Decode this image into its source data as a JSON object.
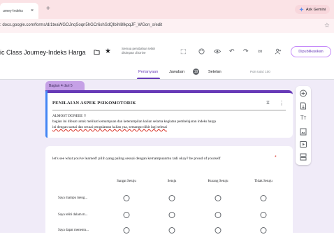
{
  "browser": {
    "tab_title": "urney-Indeks",
    "tab_close": "×",
    "new_tab": "+",
    "ask_gemini": "Ask Gemini",
    "url": ": docs.google.com/forms/d/1teaWGOJnqSoqn5hGCr6shSdQIbihl8IkpqJF_WGon_s/edit",
    "bookmark_star": "☆"
  },
  "app": {
    "title": "ic Class Journey-Indeks Harga",
    "saved_line1": "Semua perubahan telah",
    "saved_line2": "disimpan di Drive",
    "publish_label": "Dipublikasikan",
    "tabs": [
      {
        "label": "Pertanyaan",
        "active": true
      },
      {
        "label": "Jawaban",
        "active": false
      },
      {
        "label": "Setelan",
        "active": false
      }
    ],
    "responses_badge": "19",
    "points": "Poin total: 100"
  },
  "section": {
    "tag": "Bagian 4 dari 5",
    "title": "PENILAIAN ASPEK PSIKOMOTORIK",
    "desc_line1": "ALMOST DONEEE !!",
    "desc_line2": "bagian ini dibuat untuk melihat kemampuan dan keterampilan kalian selama kegiatan pembelajaran indeks harga",
    "desc_line3": "ini dengan santai dan sesuai pengalaman kalian yaa, semangat dikit lagi selesai"
  },
  "question": {
    "text": "let's see what you've learned! pilih yang paling sesuai dengan kemampuanmu tadi okay? be proud of yourself",
    "required": "*",
    "columns": [
      "Sangat Setuju",
      "Setuju",
      "Kurang Setuju",
      "Tidak Setuju"
    ],
    "rows": [
      "Saya mampu meng...",
      "Saya teliti dalam m...",
      "Saya dapat menentu..."
    ]
  },
  "colors": {
    "accent": "#673ab7",
    "canvas": "#f0ebf8",
    "tabbar": "#fbe3e6",
    "section_tag": "#c5a0e6"
  },
  "side_panel_icons": [
    "add-question-icon",
    "import-questions-icon",
    "add-title-icon",
    "add-image-icon",
    "add-video-icon",
    "add-section-icon"
  ]
}
